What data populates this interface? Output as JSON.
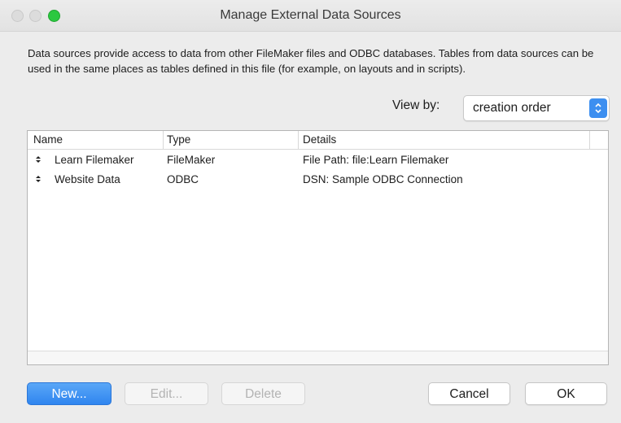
{
  "window": {
    "title": "Manage External Data Sources"
  },
  "description": "Data sources provide access to data from other FileMaker files and ODBC databases. Tables from data sources can be used in the same places as tables defined in this file (for example, on layouts and in scripts).",
  "view_by": {
    "label": "View by:",
    "selected": "creation order"
  },
  "table": {
    "columns": [
      "Name",
      "Type",
      "Details"
    ],
    "rows": [
      {
        "name": "Learn Filemaker",
        "type": "FileMaker",
        "details": "File Path: file:Learn Filemaker"
      },
      {
        "name": "Website Data",
        "type": "ODBC",
        "details": "DSN: Sample ODBC Connection"
      }
    ]
  },
  "buttons": {
    "new": "New...",
    "edit": "Edit...",
    "delete": "Delete",
    "cancel": "Cancel",
    "ok": "OK"
  },
  "colors": {
    "accent": "#3d8ff0",
    "close_light": "#dcdcdc",
    "zoom_light": "#2bc840"
  }
}
